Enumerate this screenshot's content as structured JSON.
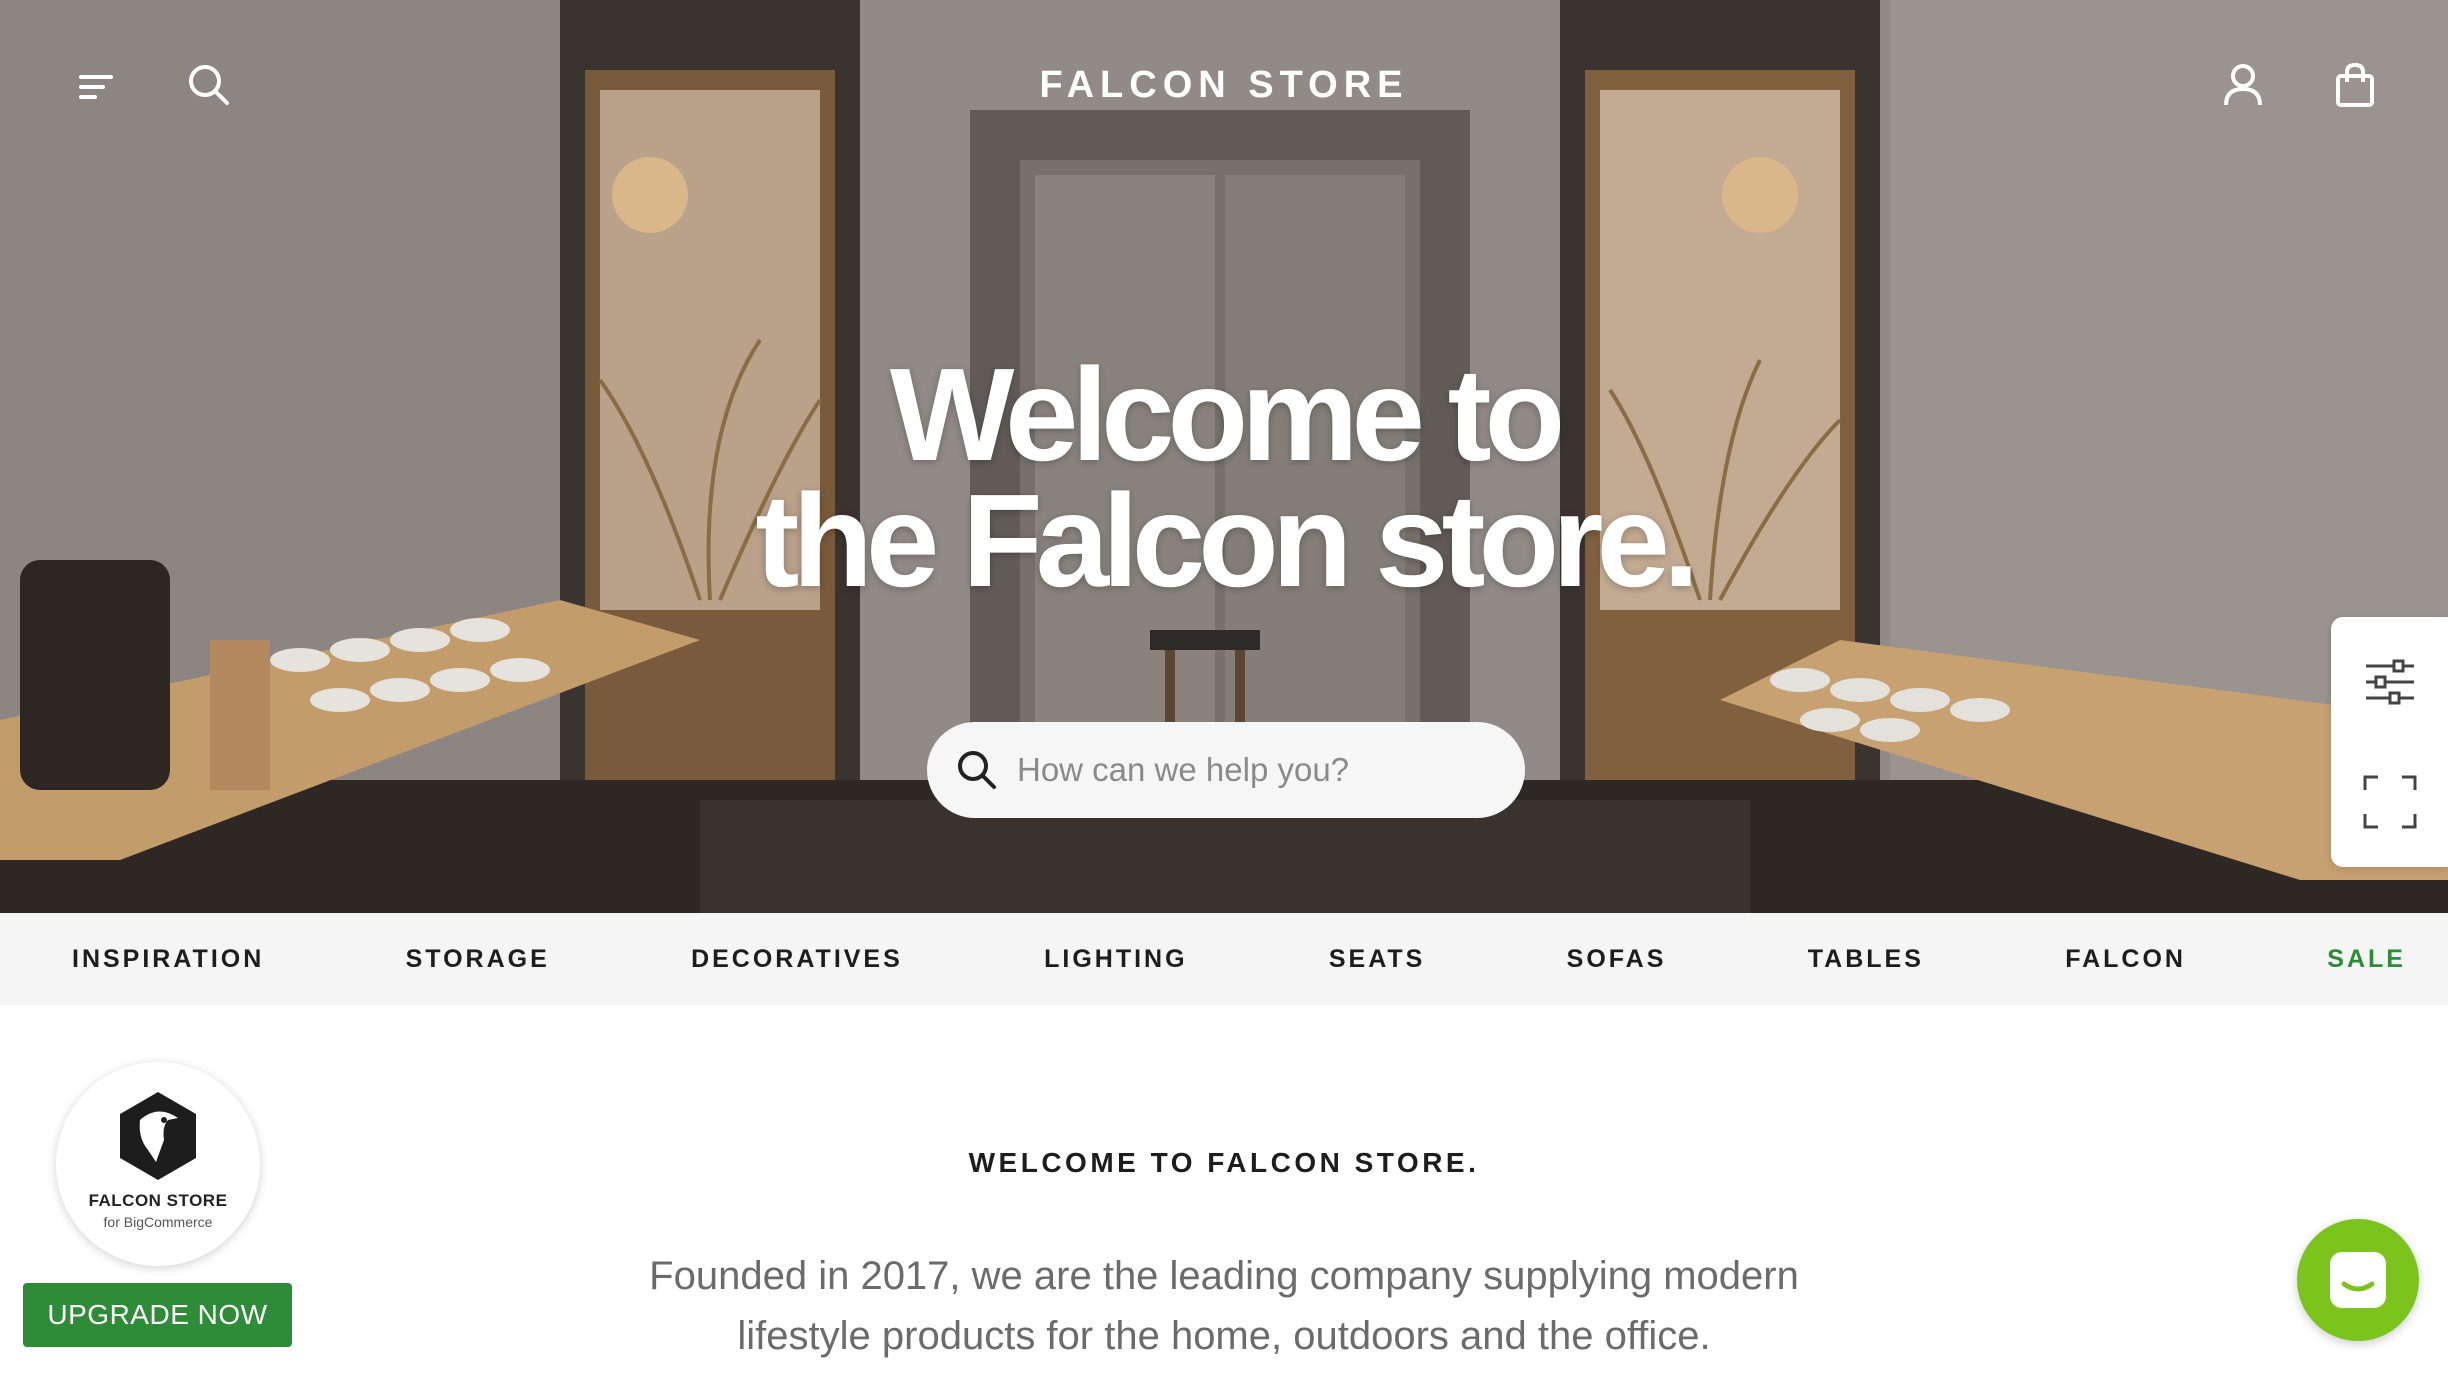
{
  "header": {
    "brand": "FALCON STORE",
    "menu_icon": "menu-icon",
    "search_icon": "search-icon",
    "account_icon": "user-icon",
    "cart_icon": "shopping-bag-icon"
  },
  "hero": {
    "headline_line1": "Welcome to",
    "headline_line2": "the Falcon store.",
    "search_placeholder": "How can we help you?"
  },
  "side_tools": {
    "items": [
      "sliders-icon",
      "fullscreen-icon"
    ]
  },
  "categories": [
    {
      "label": "INSPIRATION"
    },
    {
      "label": "STORAGE"
    },
    {
      "label": "DECORATIVES"
    },
    {
      "label": "LIGHTING"
    },
    {
      "label": "SEATS"
    },
    {
      "label": "SOFAS"
    },
    {
      "label": "TABLES"
    },
    {
      "label": "FALCON"
    },
    {
      "label": "SALE"
    }
  ],
  "intro": {
    "title": "WELCOME TO FALCON STORE.",
    "text": "Founded in 2017, we are the leading company supplying modern lifestyle products for the home, outdoors and the office."
  },
  "badge": {
    "name": "FALCON STORE",
    "sub": "for BigCommerce"
  },
  "upgrade_label": "UPGRADE NOW",
  "colors": {
    "accent": "#2e8b37",
    "chat": "#7cc31d",
    "nav_bg": "#f5f5f5"
  }
}
